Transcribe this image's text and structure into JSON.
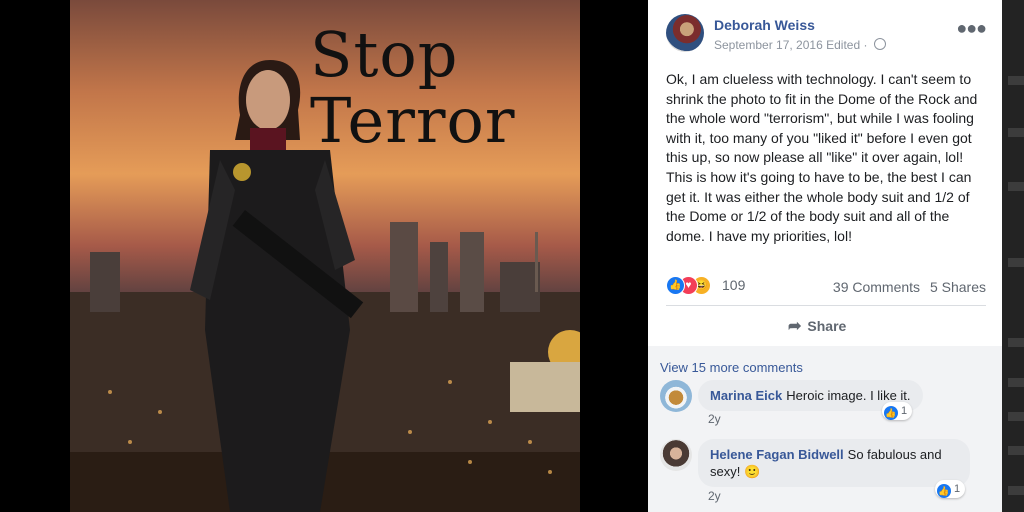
{
  "photo": {
    "title_line1": "Stop",
    "title_line2": "Terror"
  },
  "post": {
    "author": "Deborah Weiss",
    "date": "September 17, 2016",
    "edited": "Edited",
    "separator": "·",
    "text": "Ok, I am clueless with technology. I can't seem to shrink the photo to fit in the Dome of the Rock and the whole word \"terrorism\", but while I was fooling with it, too many of you \"liked it\" before I even got this up, so now please all \"like\" it over again, lol! This is how it's going to have to be, the best I can get it. It was either the whole body suit and 1/2 of the Dome or 1/2 of the body suit and all of the dome. I have my priorities, lol!",
    "reaction_count": "109",
    "comments_count": "39 Comments",
    "shares_count": "5 Shares",
    "share_label": "Share",
    "more_icon": "more-options-icon",
    "privacy_icon": "globe-icon"
  },
  "comments": {
    "view_more": "View 15 more comments",
    "items": [
      {
        "author": "Marina Eick",
        "text": "Heroic image. I like it.",
        "likes": "1",
        "age": "2y"
      },
      {
        "author": "Helene Fagan Bidwell",
        "text": "So fabulous and sexy! 🙂",
        "likes": "1",
        "age": "2y"
      }
    ]
  },
  "colors": {
    "link_blue": "#385898",
    "like_blue": "#1877f2",
    "love_red": "#f33e58",
    "haha_yellow": "#f7b125",
    "bubble_bg": "#e9ebee",
    "comments_bg": "#f2f3f5"
  }
}
